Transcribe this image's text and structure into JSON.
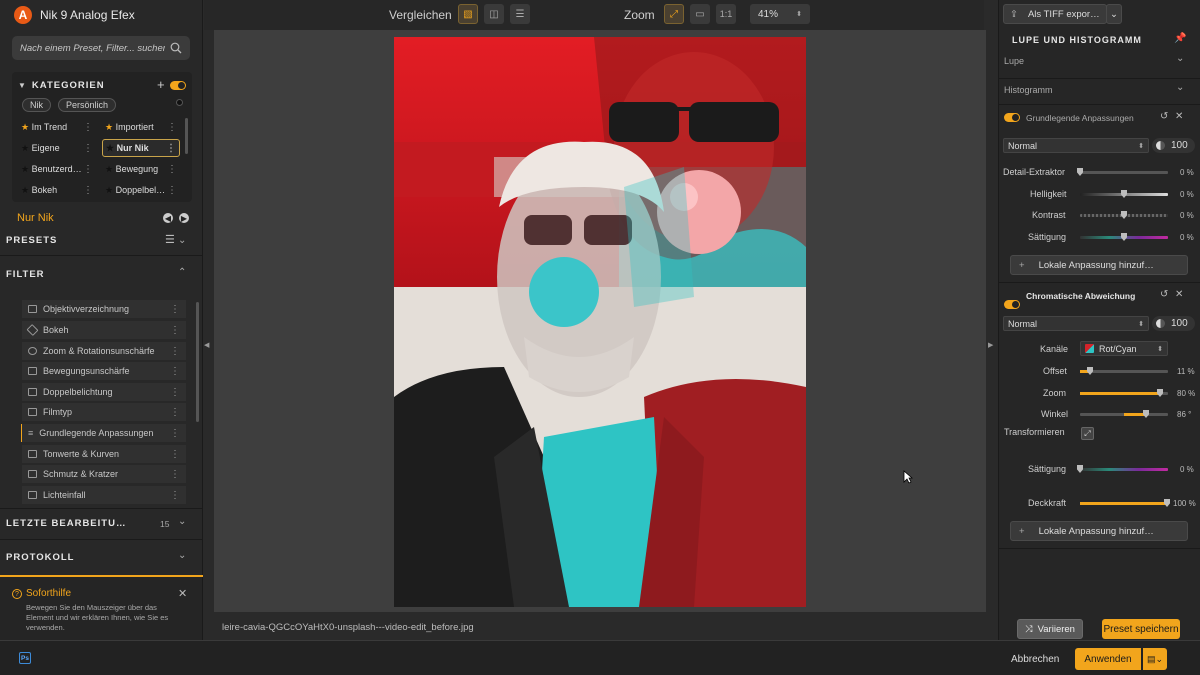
{
  "app": {
    "title": "Nik 9 Analog Efex",
    "logo_letter": "A"
  },
  "search": {
    "placeholder": "Nach einem Preset, Filter... suchen"
  },
  "categories": {
    "header": "KATEGORIEN",
    "pills": [
      "Nik",
      "Persönlich"
    ],
    "items": [
      {
        "label": "Im Trend",
        "star": "filled"
      },
      {
        "label": "Importiert",
        "star": "filled"
      },
      {
        "label": "Eigene",
        "star": "outline"
      },
      {
        "label": "Nur Nik",
        "star": "outline"
      },
      {
        "label": "Benutzerd…",
        "star": "outline"
      },
      {
        "label": "Bewegung",
        "star": "outline"
      },
      {
        "label": "Bokeh",
        "star": "outline"
      },
      {
        "label": "Doppelbel…",
        "star": "outline"
      }
    ],
    "selected": "Nur Nik"
  },
  "current_category": "Nur Nik",
  "presets": {
    "header": "PRESETS"
  },
  "filter": {
    "header": "FILTER",
    "items": [
      "Objektivverzeichnung",
      "Bokeh",
      "Zoom & Rotationsunschärfe",
      "Bewegungsunschärfe",
      "Doppelbelichtung",
      "Filmtyp",
      "Grundlegende Anpassungen",
      "Tonwerte & Kurven",
      "Schmutz & Kratzer",
      "Lichteinfall"
    ],
    "active": "Grundlegende Anpassungen"
  },
  "recent": {
    "header": "LETZTE BEARBEITU…",
    "count": "15"
  },
  "protocol": {
    "header": "PROTOKOLL"
  },
  "help": {
    "title": "Soforthilfe",
    "text": "Bewegen Sie den Mauszeiger über das Element und wir erklären Ihnen, wie Sie es verwenden."
  },
  "toolbar": {
    "compare_label": "Vergleichen",
    "zoom_label": "Zoom",
    "zoom_ratio": "1:1",
    "zoom_value": "41%"
  },
  "file": {
    "name": "leire-cavia-QGCcOYaHtX0-unsplash---video-edit_before.jpg"
  },
  "right": {
    "export_label": "Als TIFF expor…",
    "loupe_header": "LUPE UND HISTOGRAMM",
    "lupe": "Lupe",
    "histogramm": "Histogramm",
    "basic": {
      "title": "Grundlegende Anpassungen",
      "blend": "Normal",
      "opacity": "100",
      "sliders": [
        {
          "label": "Detail-Extraktor",
          "value": "0 %",
          "level": 0
        },
        {
          "label": "Helligkeit",
          "value": "0 %",
          "level": 0.5
        },
        {
          "label": "Kontrast",
          "value": "0 %",
          "level": 0.5
        },
        {
          "label": "Sättigung",
          "value": "0 %",
          "level": 0.5
        }
      ],
      "local_btn": "Lokale Anpassung hinzuf…"
    },
    "chroma": {
      "title": "Chromatische Abweichung",
      "blend": "Normal",
      "opacity": "100",
      "channels_label": "Kanäle",
      "channels_value": "Rot/Cyan",
      "sliders": [
        {
          "label": "Offset",
          "value": "11 %",
          "level": 0.11
        },
        {
          "label": "Zoom",
          "value": "80 %",
          "level": 0.9
        },
        {
          "label": "Winkel",
          "value": "86 °",
          "level": 0.74
        }
      ],
      "transform_label": "Transformieren",
      "saturation": {
        "label": "Sättigung",
        "value": "0 %",
        "level": 0
      },
      "opacity_slider": {
        "label": "Deckkraft",
        "value": "100 %",
        "level": 1
      },
      "local_btn": "Lokale Anpassung hinzuf…"
    },
    "vary_btn": "Variieren",
    "save_preset_btn": "Preset speichern"
  },
  "bottom": {
    "ps_badge": "Ps",
    "cancel": "Abbrechen",
    "apply": "Anwenden"
  },
  "colors": {
    "accent": "#f2a51c",
    "red_channel": "#d3232a",
    "cyan_channel": "#2ec4c4"
  }
}
